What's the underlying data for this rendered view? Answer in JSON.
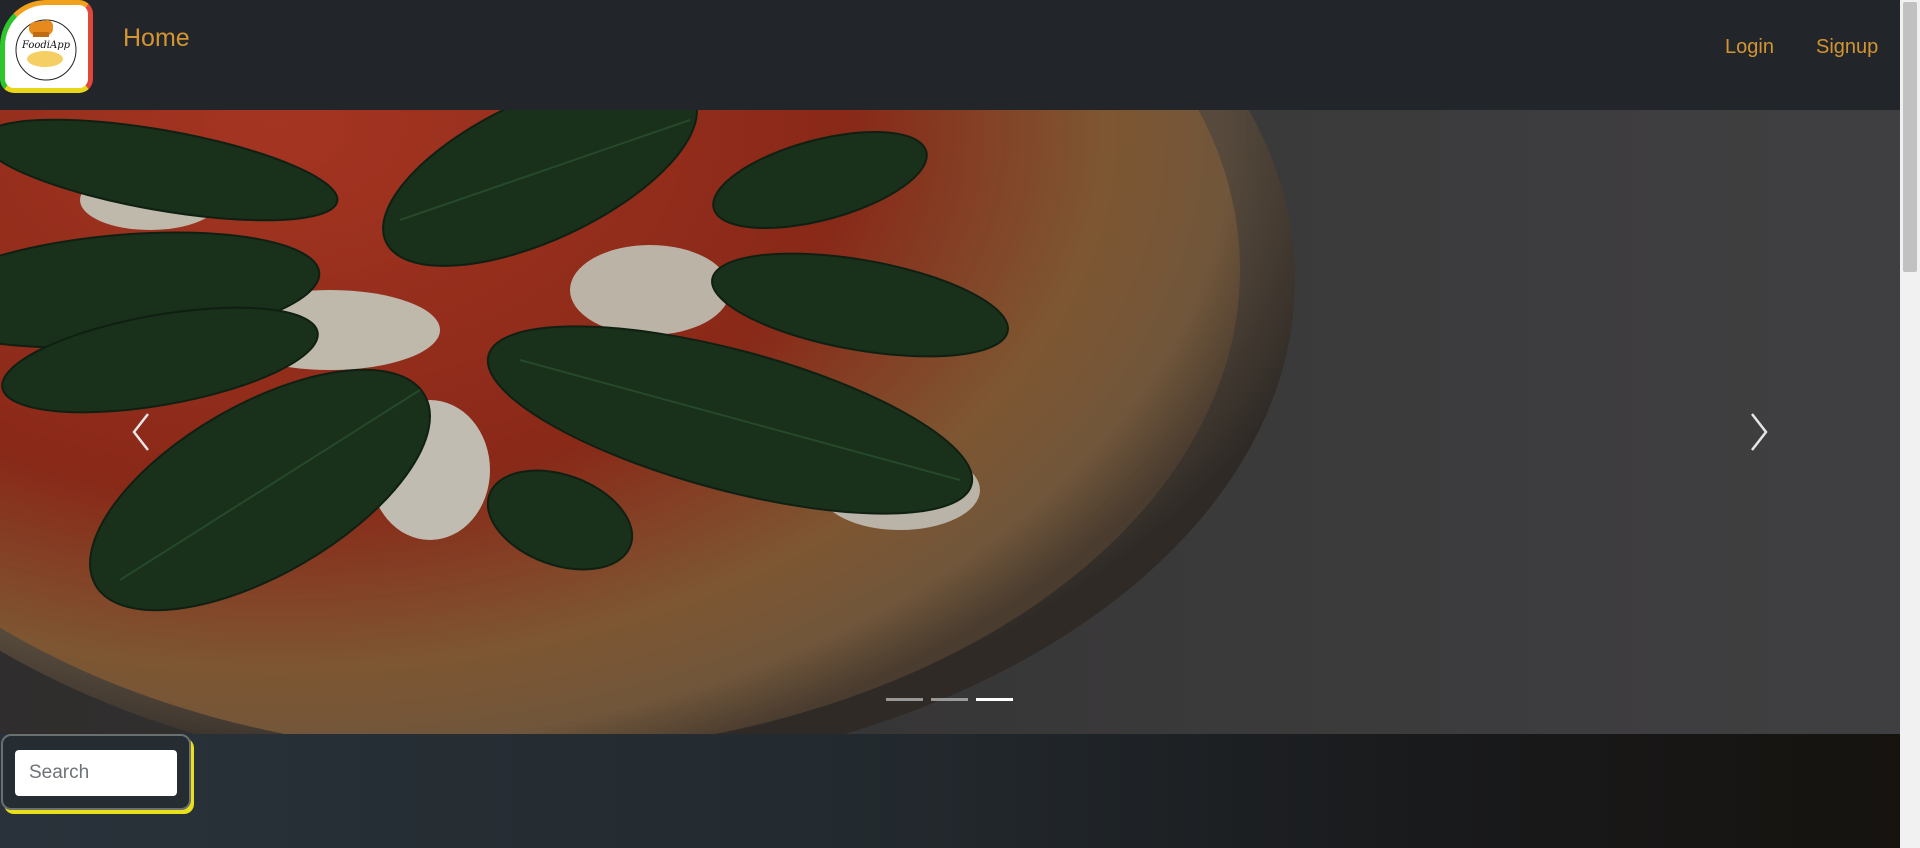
{
  "navbar": {
    "logo_text": "FoodiApp",
    "home_label": "Home",
    "login_label": "Login",
    "signup_label": "Signup",
    "accent_color": "#d39531"
  },
  "carousel": {
    "slide_count": 3,
    "active_index": 2,
    "prev_icon": "chevron-left-icon",
    "next_icon": "chevron-right-icon"
  },
  "search": {
    "placeholder": "Search",
    "value": ""
  }
}
